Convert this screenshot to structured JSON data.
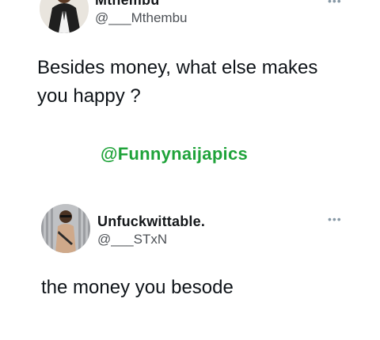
{
  "tweet": {
    "display_name": "Mthembu",
    "handle": "@___Mthembu",
    "text": "Besides money, what else makes you happy ?",
    "more_icon": "more-dots-icon"
  },
  "watermark": {
    "text": "@Funnynaijapics",
    "color": "#1fa33a"
  },
  "reply": {
    "display_name": "Unfuckwittable.",
    "handle": "@___STxN",
    "text": "the money you besode",
    "more_icon": "more-dots-icon"
  }
}
